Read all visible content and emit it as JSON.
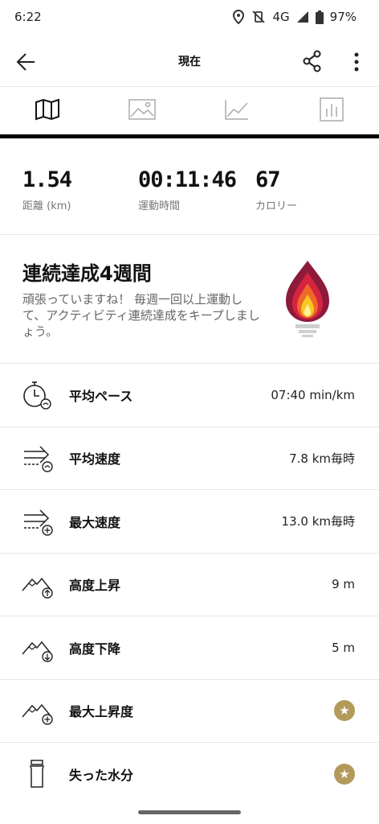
{
  "status": {
    "time": "6:22",
    "network": "4G",
    "battery": "97%"
  },
  "appbar": {
    "title": "現在"
  },
  "tabs": [
    {
      "icon": "map-icon",
      "active": true
    },
    {
      "icon": "image-icon",
      "active": false
    },
    {
      "icon": "line-chart-icon",
      "active": false
    },
    {
      "icon": "bar-chart-icon",
      "active": false
    }
  ],
  "summary": {
    "distance_value": "1.54",
    "distance_label": "距離 (km)",
    "duration_value": "00:11:46",
    "duration_label": "運動時間",
    "calories_value": "67",
    "calories_label": "カロリー"
  },
  "streak": {
    "title": "連続達成4週間",
    "message": "頑張っていますね！ 毎週一回以上運動して、アクティビティ連続達成をキープしましょう。"
  },
  "stats": [
    {
      "icon": "stopwatch-icon",
      "label": "平均ペース",
      "value": "07:40 min/km"
    },
    {
      "icon": "speed-average-icon",
      "label": "平均速度",
      "value": "7.8 km毎時"
    },
    {
      "icon": "speed-max-icon",
      "label": "最大速度",
      "value": "13.0 km毎時"
    },
    {
      "icon": "elevation-gain-icon",
      "label": "高度上昇",
      "value": "9 m"
    },
    {
      "icon": "elevation-loss-icon",
      "label": "高度下降",
      "value": "5 m"
    },
    {
      "icon": "max-elevation-icon",
      "label": "最大上昇度",
      "value": ""
    },
    {
      "icon": "water-bottle-icon",
      "label": "失った水分",
      "value": ""
    }
  ],
  "colors": {
    "premium_star": "#b49a5a",
    "divider": "#e6e6e6"
  }
}
